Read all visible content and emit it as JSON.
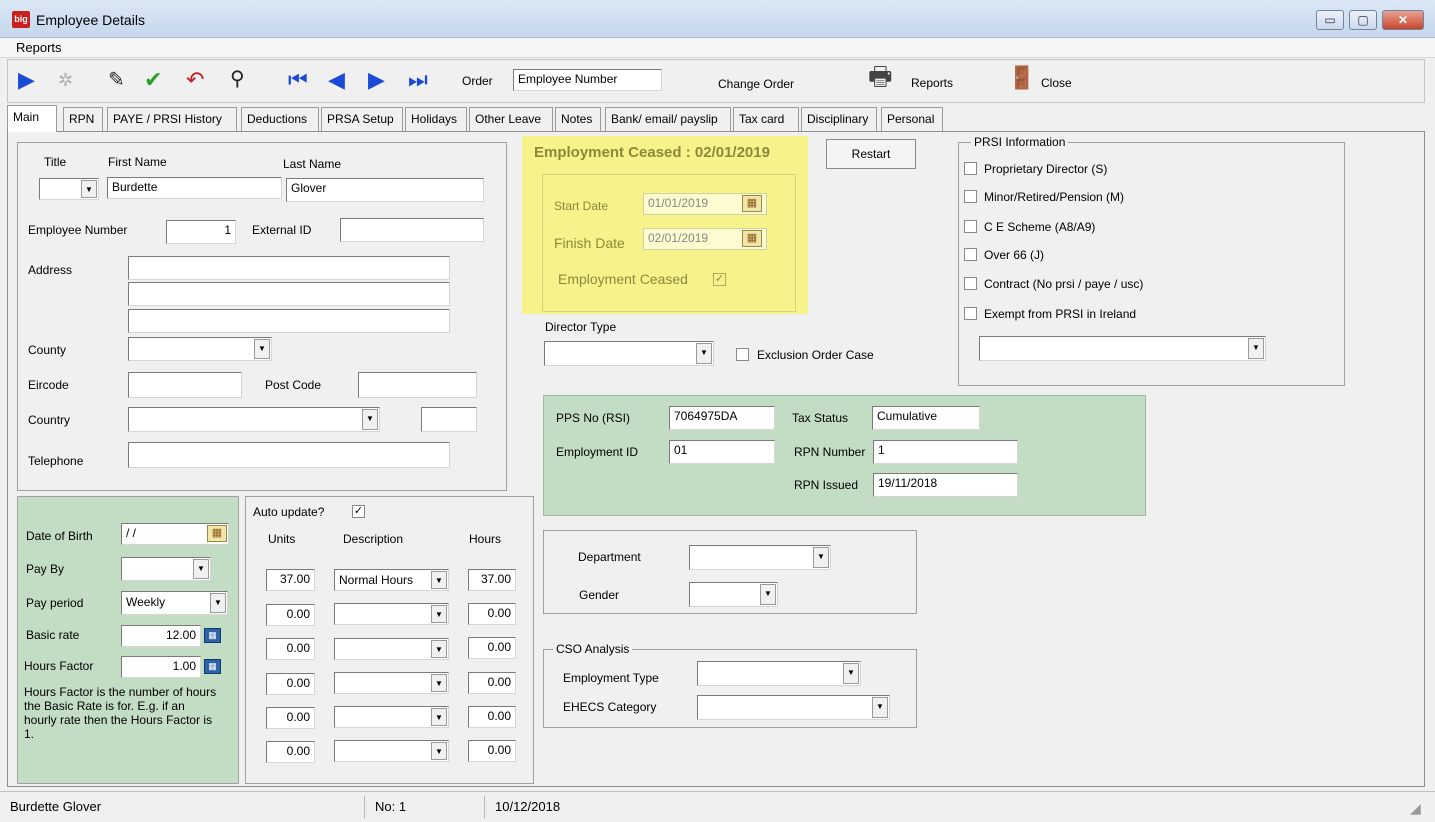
{
  "window": {
    "title": "Employee Details",
    "icon_text": "big",
    "min": "▭",
    "max": "▢",
    "close": "✕"
  },
  "menu": {
    "reports": "Reports"
  },
  "toolbar": {
    "order_label": "Order",
    "order_value": "Employee Number",
    "change_order": "Change Order",
    "reports": "Reports",
    "close": "Close"
  },
  "tabs": [
    "Main",
    "RPN",
    "PAYE / PRSI History",
    "Deductions",
    "PRSA Setup",
    "Holidays",
    "Other Leave",
    "Notes",
    "Bank/ email/ payslip",
    "Tax card",
    "Disciplinary",
    "Personal"
  ],
  "personal": {
    "title_label": "Title",
    "first_name_label": "First Name",
    "last_name_label": "Last Name",
    "title_value": "",
    "first_name": "Burdette",
    "last_name": "Glover",
    "employee_number_label": "Employee Number",
    "employee_number": "1",
    "external_id_label": "External ID",
    "external_id": "",
    "address_label": "Address",
    "address1": "",
    "address2": "",
    "address3": "",
    "county_label": "County",
    "county": "",
    "eircode_label": "Eircode",
    "eircode": "",
    "post_code_label": "Post Code",
    "post_code": "",
    "country_label": "Country",
    "country": "",
    "country_code": "",
    "telephone_label": "Telephone",
    "telephone": ""
  },
  "pay": {
    "dob_label": "Date of Birth",
    "dob": "/ /",
    "pay_by_label": "Pay By",
    "pay_by": "",
    "pay_period_label": "Pay period",
    "pay_period": "Weekly",
    "basic_rate_label": "Basic rate",
    "basic_rate": "12.00",
    "hours_factor_label": "Hours Factor",
    "hours_factor": "1.00",
    "note": "Hours Factor is the number of hours the Basic Rate is for. E.g. if an hourly rate then the Hours Factor is 1."
  },
  "hours_grid": {
    "auto_update_label": "Auto update?",
    "auto_update_checked": "✓",
    "units_label": "Units",
    "description_label": "Description",
    "hours_label": "Hours",
    "rows": [
      {
        "units": "37.00",
        "description": "Normal Hours",
        "hours": "37.00"
      },
      {
        "units": "0.00",
        "description": "",
        "hours": "0.00"
      },
      {
        "units": "0.00",
        "description": "",
        "hours": "0.00"
      },
      {
        "units": "0.00",
        "description": "",
        "hours": "0.00"
      },
      {
        "units": "0.00",
        "description": "",
        "hours": "0.00"
      },
      {
        "units": "0.00",
        "description": "",
        "hours": "0.00"
      }
    ]
  },
  "employment": {
    "ceased_banner": "Employment Ceased :  02/01/2019",
    "restart": "Restart",
    "start_date_label": "Start Date",
    "start_date": "01/01/2019",
    "finish_date_label": "Finish Date",
    "finish_date": "02/01/2019",
    "ceased_label": "Employment Ceased",
    "ceased_checked": "✓",
    "director_type_label": "Director Type",
    "director_type": "",
    "exclusion_label": "Exclusion Order Case"
  },
  "prsi": {
    "title": "PRSI Information",
    "options": [
      "Proprietary Director (S)",
      "Minor/Retired/Pension (M)",
      "C E Scheme (A8/A9)",
      "Over 66 (J)",
      "Contract (No prsi / paye / usc)",
      "Exempt from PRSI in Ireland"
    ],
    "combo": ""
  },
  "tax": {
    "pps_label": "PPS No (RSI)",
    "pps": "7064975DA",
    "tax_status_label": "Tax Status",
    "tax_status": "Cumulative",
    "employment_id_label": "Employment ID",
    "employment_id": "01",
    "rpn_number_label": "RPN Number",
    "rpn_number": "1",
    "rpn_issued_label": "RPN Issued",
    "rpn_issued": "19/11/2018"
  },
  "dept": {
    "department_label": "Department",
    "department": "",
    "gender_label": "Gender",
    "gender": ""
  },
  "cso": {
    "title": "CSO Analysis",
    "employment_type_label": "Employment Type",
    "employment_type": "",
    "ehecs_label": "EHECS Category",
    "ehecs": ""
  },
  "status": {
    "name": "Burdette Glover",
    "no": "No: 1",
    "date": "10/12/2018"
  },
  "colors": {
    "green_panel": "#c3dcc4",
    "yellow_panel": "#f6f38a",
    "banner_text": "#8a8a3a"
  }
}
